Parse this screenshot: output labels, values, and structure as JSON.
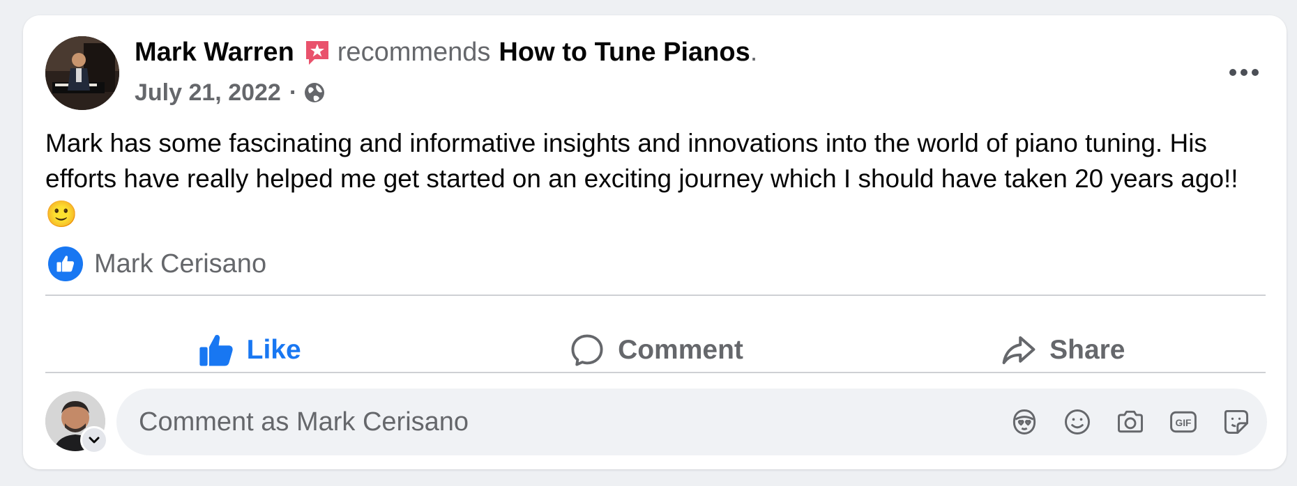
{
  "post": {
    "author": "Mark Warren",
    "action_text": "recommends",
    "page_name": "How to Tune Pianos",
    "page_suffix": ".",
    "date": "July 21, 2022",
    "separator": "·",
    "audience_icon": "globe-icon",
    "more_icon": "more-options-icon",
    "body": "Mark has some fascinating and informative insights and innovations into the world of piano tuning. His efforts have really helped me get started on an exciting journey which I should have taken 20 years ago!! 🙂"
  },
  "reactions": {
    "icon": "like-reaction-icon",
    "names": "Mark Cerisano"
  },
  "actions": {
    "like_label": "Like",
    "comment_label": "Comment",
    "share_label": "Share"
  },
  "comment_composer": {
    "placeholder": "Comment as Mark Cerisano",
    "value": "",
    "tools": [
      "avatar-sticker-icon",
      "emoji-icon",
      "camera-icon",
      "gif-icon",
      "sticker-icon"
    ]
  },
  "colors": {
    "accent_blue": "#1877f2",
    "secondary_text": "#65676b",
    "primary_text": "#050505",
    "recommend_badge": "#e9526c"
  }
}
